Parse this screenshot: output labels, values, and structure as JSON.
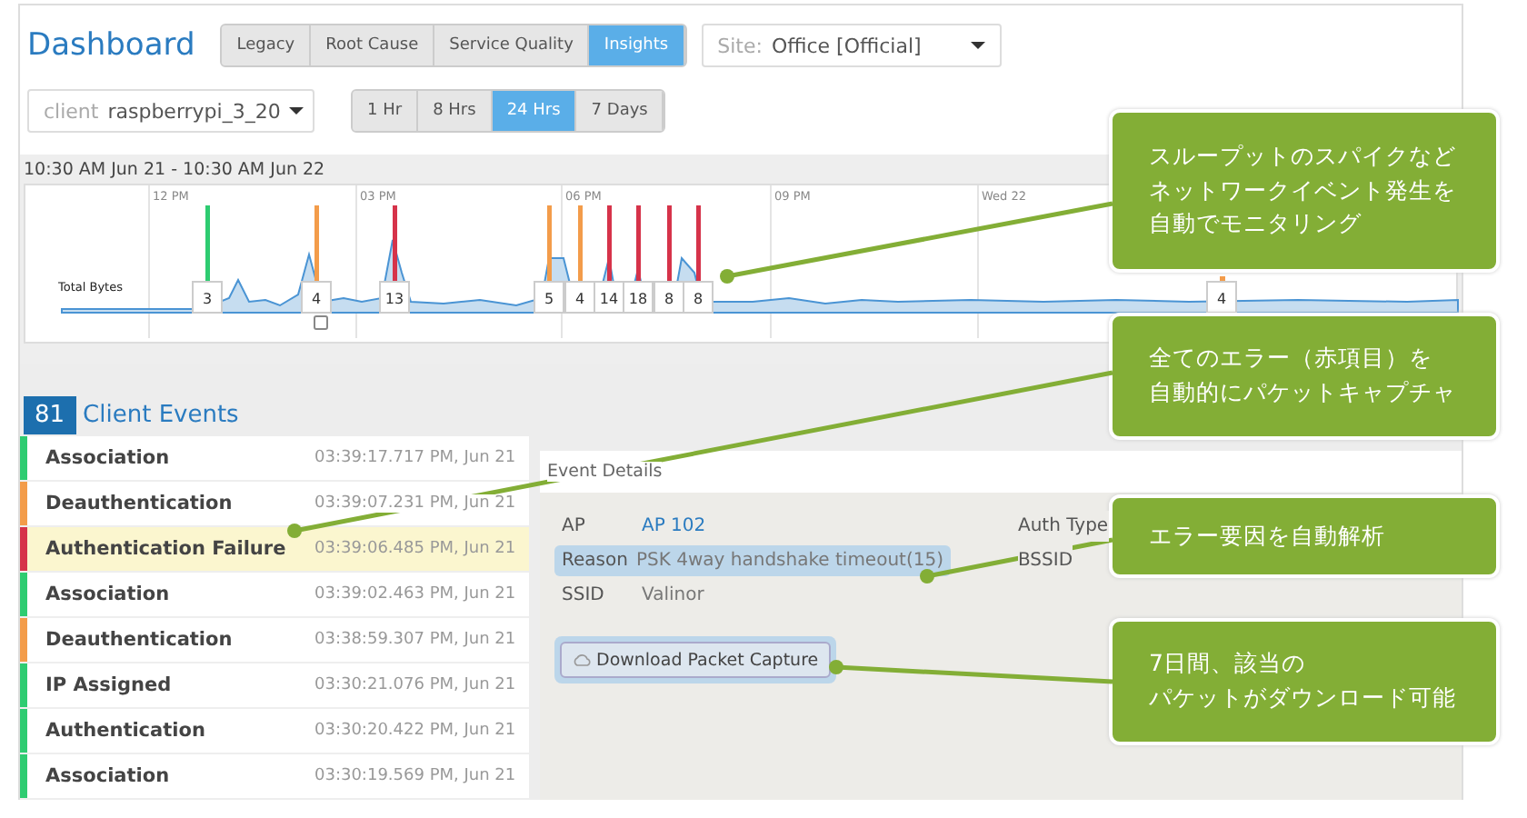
{
  "header": {
    "title": "Dashboard",
    "view_tabs": [
      {
        "label": "Legacy",
        "selected": false
      },
      {
        "label": "Root Cause",
        "selected": false
      },
      {
        "label": "Service Quality",
        "selected": false
      },
      {
        "label": "Insights",
        "selected": true
      }
    ],
    "site": {
      "label": "Site:",
      "value": "Office [Official]"
    }
  },
  "client": {
    "label": "client",
    "value": "raspberrypi_3_20"
  },
  "time_tabs": [
    {
      "label": "1 Hr",
      "selected": false
    },
    {
      "label": "8 Hrs",
      "selected": false
    },
    {
      "label": "24 Hrs",
      "selected": true
    },
    {
      "label": "7 Days",
      "selected": false
    }
  ],
  "timeline": {
    "range": "10:30 AM Jun 21 - 10:30 AM Jun 22",
    "axis_labels": [
      "12 PM",
      "03 PM",
      "06 PM",
      "09 PM",
      "Wed 22"
    ],
    "series_label": "Total Bytes",
    "events": [
      {
        "count": "3",
        "color": "#2ecc71"
      },
      {
        "count": "4",
        "color": "#f39c4a"
      },
      {
        "count": "13",
        "color": "#d6334a"
      },
      {
        "count": "5",
        "color": "#f39c4a"
      },
      {
        "count": "4",
        "color": "#f39c4a"
      },
      {
        "count": "14",
        "color": "#d6334a"
      },
      {
        "count": "18",
        "color": "#d6334a"
      },
      {
        "count": "8",
        "color": "#d6334a"
      },
      {
        "count": "8",
        "color": "#d6334a"
      },
      {
        "count": "4",
        "color": "#f39c4a"
      }
    ]
  },
  "client_events": {
    "count": "81",
    "title": "Client Events",
    "items": [
      {
        "name": "Association",
        "time": "03:39:17.717 PM, Jun 21",
        "color": "#2ecc71",
        "selected": false
      },
      {
        "name": "Deauthentication",
        "time": "03:39:07.231 PM, Jun 21",
        "color": "#f39c4a",
        "selected": false
      },
      {
        "name": "Authentication Failure",
        "time": "03:39:06.485 PM, Jun 21",
        "color": "#d6334a",
        "selected": true
      },
      {
        "name": "Association",
        "time": "03:39:02.463 PM, Jun 21",
        "color": "#2ecc71",
        "selected": false
      },
      {
        "name": "Deauthentication",
        "time": "03:38:59.307 PM, Jun 21",
        "color": "#f39c4a",
        "selected": false
      },
      {
        "name": "IP Assigned",
        "time": "03:30:21.076 PM, Jun 21",
        "color": "#2ecc71",
        "selected": false
      },
      {
        "name": "Authentication",
        "time": "03:30:20.422 PM, Jun 21",
        "color": "#2ecc71",
        "selected": false
      },
      {
        "name": "Association",
        "time": "03:30:19.569 PM, Jun 21",
        "color": "#2ecc71",
        "selected": false
      }
    ]
  },
  "event_details": {
    "title": "Event Details",
    "fields": [
      {
        "label": "AP",
        "value": "AP 102",
        "kind": "link",
        "highlighted": false
      },
      {
        "label": "Reason",
        "value": "PSK 4way handshake timeout(15)",
        "kind": "text",
        "highlighted": true
      },
      {
        "label": "SSID",
        "value": "Valinor",
        "kind": "text",
        "highlighted": false
      }
    ],
    "side_labels": [
      "Auth Type",
      "BSSID"
    ],
    "download": {
      "label": "Download Packet Capture",
      "highlighted": true
    }
  },
  "callouts": [
    {
      "lines": [
        "スループットのスパイクなど",
        "ネットワークイベント発生を",
        "自動でモニタリング"
      ]
    },
    {
      "lines": [
        "全てのエラー（赤項目）を",
        "自動的にパケットキャプチャ"
      ]
    },
    {
      "lines": [
        "エラー要因を自動解析"
      ]
    },
    {
      "lines": [
        "7日間、該当の",
        "パケットがダウンロード可能"
      ]
    }
  ]
}
